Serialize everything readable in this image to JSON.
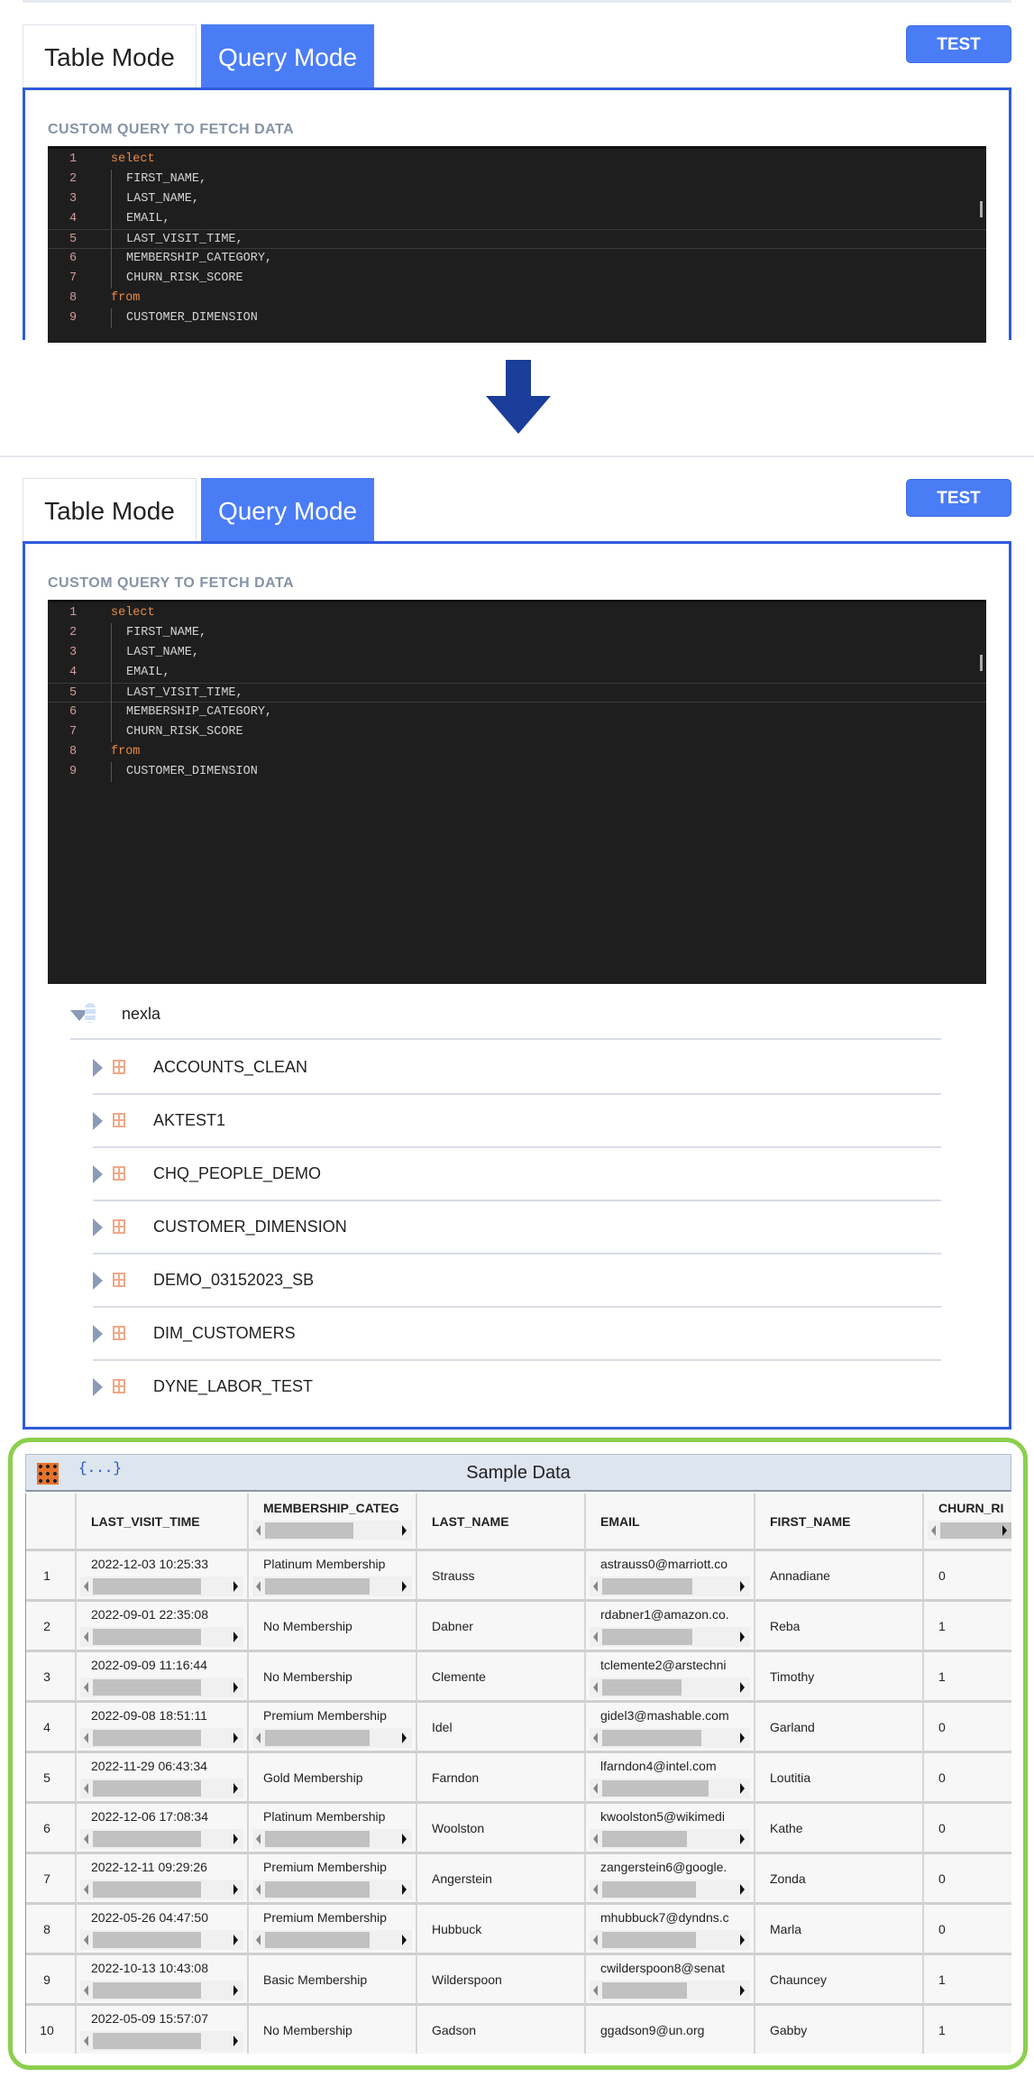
{
  "tabs": {
    "table_mode": "Table Mode",
    "query_mode": "Query Mode",
    "active": "Query Mode"
  },
  "test_label": "TEST",
  "query_label": "CUSTOM QUERY TO FETCH DATA",
  "query_lines": [
    {
      "n": "1",
      "text": "select",
      "kw": true
    },
    {
      "n": "2",
      "text": "FIRST_NAME,"
    },
    {
      "n": "3",
      "text": "LAST_NAME,"
    },
    {
      "n": "4",
      "text": "EMAIL,"
    },
    {
      "n": "5",
      "text": "LAST_VISIT_TIME,",
      "current": true
    },
    {
      "n": "6",
      "text": "MEMBERSHIP_CATEGORY,"
    },
    {
      "n": "7",
      "text": "CHURN_RISK_SCORE"
    },
    {
      "n": "8",
      "text": "from",
      "kw": true
    },
    {
      "n": "9",
      "text": "CUSTOMER_DIMENSION"
    }
  ],
  "tree": {
    "root": "nexla",
    "tables": [
      "ACCOUNTS_CLEAN",
      "AKTEST1",
      "CHQ_PEOPLE_DEMO",
      "CUSTOMER_DIMENSION",
      "DEMO_03152023_SB",
      "DIM_CUSTOMERS",
      "DYNE_LABOR_TEST"
    ]
  },
  "sample": {
    "title": "Sample Data",
    "json_icon_label": "{...}",
    "columns": [
      "",
      "LAST_VISIT_TIME",
      "MEMBERSHIP_CATEG",
      "LAST_NAME",
      "EMAIL",
      "FIRST_NAME",
      "CHURN_RI"
    ],
    "rows": [
      [
        "1",
        "2022-12-03 10:25:33",
        "Platinum Membership",
        "Strauss",
        "astrauss0@marriott.co",
        "Annadiane",
        "0"
      ],
      [
        "2",
        "2022-09-01 22:35:08",
        "No Membership",
        "Dabner",
        "rdabner1@amazon.co.",
        "Reba",
        "1"
      ],
      [
        "3",
        "2022-09-09 11:16:44",
        "No Membership",
        "Clemente",
        "tclemente2@arstechni",
        "Timothy",
        "1"
      ],
      [
        "4",
        "2022-09-08 18:51:11",
        "Premium Membership",
        "Idel",
        "gidel3@mashable.com",
        "Garland",
        "0"
      ],
      [
        "5",
        "2022-11-29 06:43:34",
        "Gold Membership",
        "Farndon",
        "lfarndon4@intel.com",
        "Loutitia",
        "0"
      ],
      [
        "6",
        "2022-12-06 17:08:34",
        "Platinum Membership",
        "Woolston",
        "kwoolston5@wikimedi",
        "Kathe",
        "0"
      ],
      [
        "7",
        "2022-12-11 09:29:26",
        "Premium Membership",
        "Angerstein",
        "zangerstein6@google.",
        "Zonda",
        "0"
      ],
      [
        "8",
        "2022-05-26 04:47:50",
        "Premium Membership",
        "Hubbuck",
        "mhubbuck7@dyndns.c",
        "Marla",
        "0"
      ],
      [
        "9",
        "2022-10-13 10:43:08",
        "Basic Membership",
        "Wilderspoon",
        "cwilderspoon8@senat",
        "Chauncey",
        "1"
      ],
      [
        "10",
        "2022-05-09 15:57:07",
        "No Membership",
        "Gadson",
        "ggadson9@un.org",
        "Gabby",
        "1"
      ]
    ]
  },
  "colors": {
    "accent": "#4a7cf6",
    "panel_border": "#2f5bdc",
    "highlight": "#8ccf4d",
    "arrow": "#1a3e9a"
  }
}
